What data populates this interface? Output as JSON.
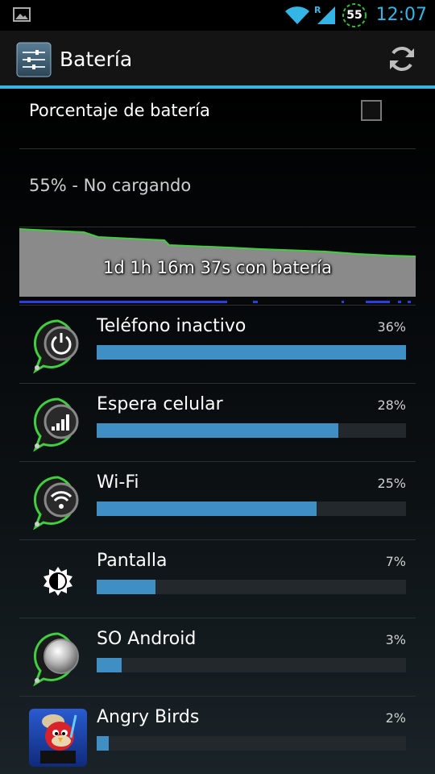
{
  "status_bar": {
    "battery_level": "55",
    "signal_roaming": "R",
    "time": "12:07"
  },
  "action_bar": {
    "title": "Batería",
    "settings_icon": "settings-icon",
    "refresh_icon": "refresh-icon"
  },
  "preference": {
    "label": "Porcentaje de batería",
    "checked": false
  },
  "battery_status": "55% - No cargando",
  "graph": {
    "label": "1d 1h 16m 37s con batería",
    "fill_color": "#8a8a8a",
    "line_color": "#3fcf3f"
  },
  "usage": [
    {
      "name": "Teléfono inactivo",
      "percent": "36%",
      "fraction": 1.0,
      "icon": "power-icon"
    },
    {
      "name": "Espera celular",
      "percent": "28%",
      "fraction": 0.78,
      "icon": "cell-signal-icon"
    },
    {
      "name": "Wi-Fi",
      "percent": "25%",
      "fraction": 0.71,
      "icon": "wifi-icon"
    },
    {
      "name": "Pantalla",
      "percent": "7%",
      "fraction": 0.19,
      "icon": "brightness-icon"
    },
    {
      "name": "SO Android",
      "percent": "3%",
      "fraction": 0.08,
      "icon": "android-os-icon"
    },
    {
      "name": "Angry Birds",
      "percent": "2%",
      "fraction": 0.04,
      "icon": "angry-birds-icon"
    }
  ],
  "colors": {
    "accent": "#33b5e5",
    "bar": "#3f8fc4",
    "bar_track": "#23282c"
  }
}
